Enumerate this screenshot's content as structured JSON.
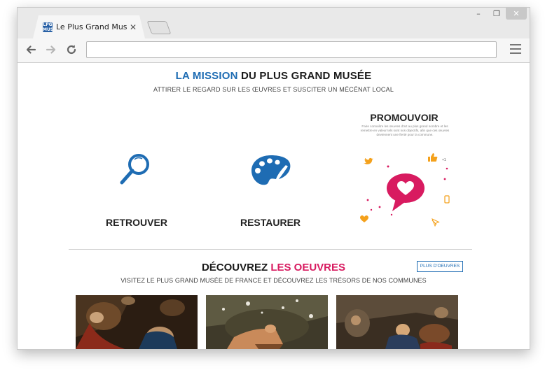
{
  "browser": {
    "tab_title": "Le Plus Grand Musée de F",
    "tab_close": "✕",
    "favicon_text": "LPG MUS",
    "address_value": "",
    "window_controls": {
      "minimize": "–",
      "restore": "❐",
      "close": "✕"
    }
  },
  "mission": {
    "title_highlight": "LA MISSION",
    "title_rest": " DU PLUS GRAND MUSÉE",
    "subtitle": "ATTIRER LE REGARD SUR LES ŒUVRES ET SUSCITER UN MÉCÉNAT LOCAL"
  },
  "features": {
    "retrouver": {
      "label": "RETROUVER",
      "icon": "magnifier-icon"
    },
    "restaurer": {
      "label": "RESTAURER",
      "icon": "palette-icon"
    },
    "promouvoir": {
      "label": "PROMOUVOIR",
      "description": "Faire connaître les œuvres d'art au plus grand nombre et les remettre en valeur tels sont nos objectifs, afin que ces œuvres deviennent une fierté pour la commune.",
      "like_count": "+1",
      "icons": [
        "heart-speech-bubble-icon",
        "twitter-icon",
        "thumbs-up-icon",
        "phone-icon",
        "heart-icon",
        "cursor-icon"
      ]
    }
  },
  "discover": {
    "title_start": "DÉCOUVREZ ",
    "title_highlight": "LES OEUVRES",
    "more_button": "PLUS D'OEUVRES",
    "subtitle": "VISITEZ LE PLUS GRAND MUSÉE DE FRANCE ET DÉCOUVREZ LES TRÉSORS DE NOS COMMUNES"
  },
  "colors": {
    "blue": "#1e6cb3",
    "pink": "#d81b60",
    "orange": "#f4a11c",
    "text": "#1a1a1a"
  }
}
